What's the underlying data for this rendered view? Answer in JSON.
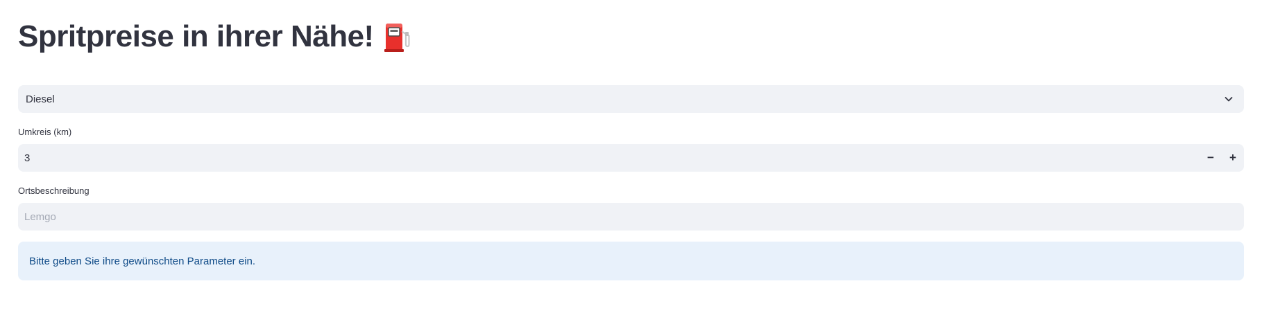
{
  "header": {
    "title": "Spritpreise in ihrer Nähe!",
    "title_icon": "fuel-pump-icon"
  },
  "fuel_select": {
    "selected_value": "Diesel",
    "icon": "chevron-down-icon"
  },
  "radius": {
    "label": "Umkreis (km)",
    "value": "3",
    "decrement_label": "−",
    "increment_label": "+"
  },
  "location": {
    "label": "Ortsbeschreibung",
    "placeholder": "Lemgo",
    "value": ""
  },
  "info": {
    "message": "Bitte geben Sie ihre gewünschten Parameter ein."
  },
  "colors": {
    "text": "#31333f",
    "input_bg": "#f0f2f6",
    "info_bg": "#e8f1fb",
    "info_text": "#0e4a87",
    "pump_red": "#e8302c"
  }
}
